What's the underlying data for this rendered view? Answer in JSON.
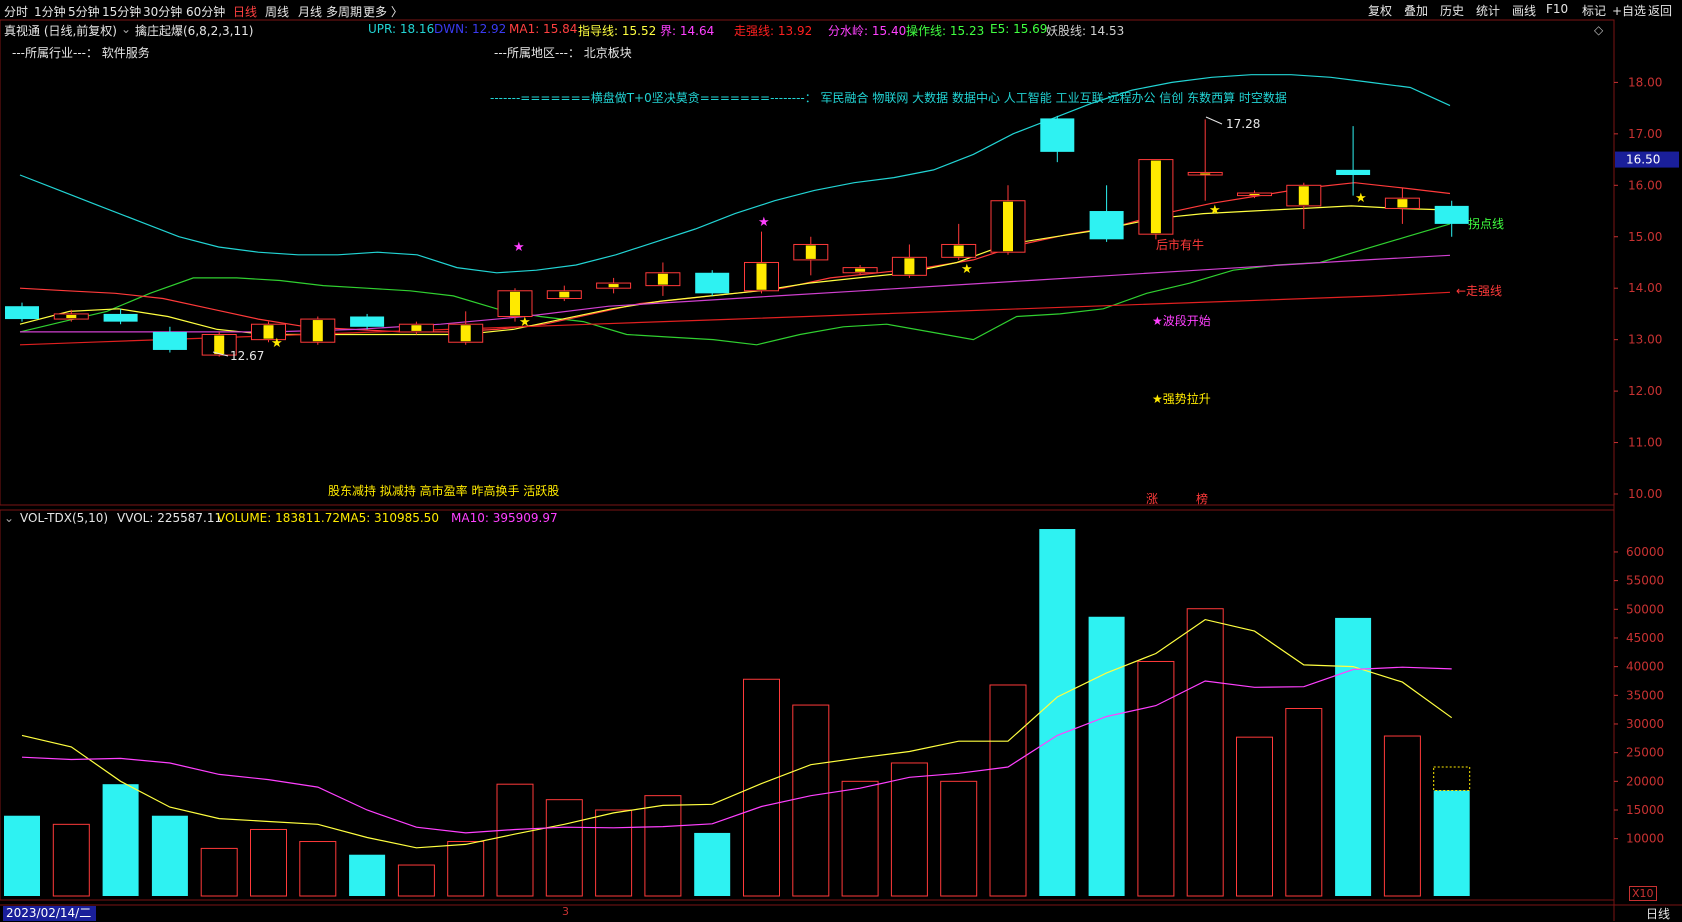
{
  "toolbar": {
    "periods": [
      "分时",
      "1分钟",
      "5分钟",
      "15分钟",
      "30分钟",
      "60分钟",
      "日线",
      "周线",
      "月线",
      "多周期",
      "更多 〉"
    ],
    "active_period": "日线",
    "right_buttons": [
      "复权",
      "叠加",
      "历史",
      "统计",
      "画线",
      "F10",
      "标记",
      "+自选",
      "返回"
    ]
  },
  "info": {
    "stock_title": "真视通 (日线,前复权)",
    "formula_name": "擒庄起爆(6,8,2,3,11)",
    "indicators": [
      {
        "label": "UPR: 18.16",
        "color": "#22d4d4"
      },
      {
        "label": "DWN: 12.92",
        "color": "#3a3af0"
      },
      {
        "label": "MA1: 15.84",
        "color": "#ff4040"
      },
      {
        "label": "指导线: 15.52",
        "color": "#ffff40"
      },
      {
        "label": "界: 14.64",
        "color": "#ff40ff"
      },
      {
        "label": "走强线: 13.92",
        "color": "#ff2020"
      },
      {
        "label": "分水岭: 15.40",
        "color": "#ff40ff"
      },
      {
        "label": "操作线: 15.23",
        "color": "#40ff40"
      },
      {
        "label": "E5: 15.69",
        "color": "#40ff40"
      },
      {
        "label": "妖股线: 14.53",
        "color": "#d0d0d0"
      }
    ],
    "industry": "---所属行业---：  软件服务",
    "region": "---所属地区---：  北京板块",
    "concept_line": "-------=======横盘做T+0坚决莫贪=======--------：  军民融合  物联网  大数据  数据中心  人工智能  工业互联  远程办公  信创  东数西算  时空数据",
    "tags": "股东减持  拟减持  高市盈率  昨高换手  活跃股"
  },
  "annotations": {
    "high_label": "17.28",
    "low_label": "12.67",
    "current_price": "16.50",
    "later_bull": "后市有牛",
    "buy_line": "拐点线",
    "strong_line": "←走强线",
    "wave_start": "★波段开始",
    "strong_pull": "★强势拉升",
    "rise_mark": "涨",
    "chip_mark": "榜",
    "diamond": "◇",
    "star_marker": "★"
  },
  "volume_info": {
    "name": "VOL-TDX(5,10)",
    "vvol": "VVOL: 225587.11",
    "volume": "VOLUME: 183811.72",
    "ma5": "MA5: 310985.50",
    "ma10": "MA10: 395909.97"
  },
  "footer": {
    "date": "2023/02/14/二",
    "period": "日线",
    "month_mark": "3",
    "x10": "X10"
  },
  "colors": {
    "up": "#ff3a3a",
    "down": "#2ef2f2",
    "upr": "#22d4d4",
    "ma1": "#ff3a3a",
    "guide": "#ffff40",
    "jie": "#d040d0",
    "strong": "#e02020",
    "green": "#30d030",
    "yellow": "#ffea00"
  },
  "chart_data": [
    {
      "type": "candlestick",
      "title": "",
      "ylim": [
        9.8,
        18.6
      ],
      "y_ticks": [
        "10.00",
        "11.00",
        "12.00",
        "13.00",
        "14.00",
        "15.00",
        "16.00",
        "17.00",
        "18.00"
      ],
      "candles": [
        {
          "o": 13.65,
          "c": 13.4,
          "h": 13.72,
          "l": 13.35
        },
        {
          "o": 13.4,
          "c": 13.5,
          "h": 13.58,
          "l": 13.35
        },
        {
          "o": 13.5,
          "c": 13.35,
          "h": 13.6,
          "l": 13.3
        },
        {
          "o": 13.15,
          "c": 12.8,
          "h": 13.25,
          "l": 12.75
        },
        {
          "o": 12.7,
          "c": 13.1,
          "h": 13.15,
          "l": 12.67
        },
        {
          "o": 13.0,
          "c": 13.3,
          "h": 13.35,
          "l": 12.95
        },
        {
          "o": 12.95,
          "c": 13.4,
          "h": 13.45,
          "l": 12.9
        },
        {
          "o": 13.45,
          "c": 13.25,
          "h": 13.5,
          "l": 13.2
        },
        {
          "o": 13.15,
          "c": 13.3,
          "h": 13.35,
          "l": 13.1
        },
        {
          "o": 12.95,
          "c": 13.3,
          "h": 13.55,
          "l": 12.9
        },
        {
          "o": 13.45,
          "c": 13.95,
          "h": 14.0,
          "l": 13.35
        },
        {
          "o": 13.8,
          "c": 13.95,
          "h": 14.05,
          "l": 13.75
        },
        {
          "o": 14.0,
          "c": 14.1,
          "h": 14.2,
          "l": 13.9
        },
        {
          "o": 14.05,
          "c": 14.3,
          "h": 14.5,
          "l": 13.85
        },
        {
          "o": 14.3,
          "c": 13.9,
          "h": 14.35,
          "l": 13.85
        },
        {
          "o": 13.95,
          "c": 14.5,
          "h": 15.1,
          "l": 13.9
        },
        {
          "o": 14.55,
          "c": 14.85,
          "h": 15.0,
          "l": 14.25
        },
        {
          "o": 14.3,
          "c": 14.4,
          "h": 14.45,
          "l": 14.25
        },
        {
          "o": 14.25,
          "c": 14.6,
          "h": 14.85,
          "l": 14.2
        },
        {
          "o": 14.6,
          "c": 14.85,
          "h": 15.25,
          "l": 14.55
        },
        {
          "o": 14.7,
          "c": 15.7,
          "h": 16.0,
          "l": 14.65
        },
        {
          "o": 17.3,
          "c": 16.65,
          "h": 17.35,
          "l": 16.45
        },
        {
          "o": 15.5,
          "c": 14.95,
          "h": 16.0,
          "l": 14.9
        },
        {
          "o": 15.05,
          "c": 16.5,
          "h": 16.5,
          "l": 14.95
        },
        {
          "o": 16.2,
          "c": 16.25,
          "h": 17.28,
          "l": 15.7
        },
        {
          "o": 15.8,
          "c": 15.85,
          "h": 15.9,
          "l": 15.75
        },
        {
          "o": 15.6,
          "c": 16.0,
          "h": 16.05,
          "l": 15.15
        },
        {
          "o": 16.3,
          "c": 16.2,
          "h": 17.15,
          "l": 15.8
        },
        {
          "o": 15.55,
          "c": 15.75,
          "h": 15.95,
          "l": 15.25
        },
        {
          "o": 15.6,
          "c": 15.25,
          "h": 15.7,
          "l": 15.0
        }
      ],
      "series": [
        {
          "name": "UPR",
          "color": "#22d4d4",
          "values": [
            16.2,
            15.9,
            15.6,
            15.3,
            15.0,
            14.8,
            14.7,
            14.65,
            14.65,
            14.7,
            14.65,
            14.4,
            14.3,
            14.35,
            14.45,
            14.65,
            14.9,
            15.15,
            15.45,
            15.7,
            15.9,
            16.05,
            16.15,
            16.3,
            16.6,
            17.0,
            17.3,
            17.6,
            17.85,
            18.0,
            18.1,
            18.15,
            18.15,
            18.1,
            18.0,
            17.9,
            17.55
          ]
        },
        {
          "name": "DWN",
          "color": "#30d030",
          "values": [
            13.15,
            13.35,
            13.55,
            13.9,
            14.2,
            14.2,
            14.15,
            14.05,
            14.0,
            13.95,
            13.85,
            13.6,
            13.45,
            13.35,
            13.1,
            13.05,
            13.0,
            12.9,
            13.1,
            13.25,
            13.3,
            13.15,
            13.0,
            13.45,
            13.5,
            13.6,
            13.9,
            14.1,
            14.35,
            14.45,
            14.5,
            14.75,
            15.0,
            15.25
          ]
        },
        {
          "name": "MA1",
          "color": "#ff3a3a",
          "values": [
            14.0,
            13.95,
            13.9,
            13.8,
            13.6,
            13.4,
            13.25,
            13.2,
            13.15,
            13.15,
            13.2,
            13.3,
            13.5,
            13.7,
            13.8,
            13.9,
            14.0,
            14.2,
            14.3,
            14.4,
            14.55,
            14.85,
            15.05,
            15.2,
            15.45,
            15.65,
            15.8,
            15.95,
            16.05,
            15.95,
            15.84
          ]
        },
        {
          "name": "指导线",
          "color": "#ffff40",
          "values": [
            13.3,
            13.55,
            13.6,
            13.45,
            13.2,
            13.1,
            13.1,
            13.1,
            13.1,
            13.1,
            13.2,
            13.4,
            13.6,
            13.75,
            13.85,
            13.95,
            14.1,
            14.2,
            14.3,
            14.5,
            14.85,
            15.0,
            15.15,
            15.35,
            15.45,
            15.5,
            15.55,
            15.6,
            15.55,
            15.52
          ]
        },
        {
          "name": "界",
          "color": "#d040d0",
          "values": [
            13.15,
            13.15,
            13.15,
            13.15,
            13.2,
            13.3,
            13.45,
            13.65,
            13.75,
            13.85,
            13.95,
            14.05,
            14.15,
            14.25,
            14.35,
            14.45,
            14.55,
            14.64
          ]
        },
        {
          "name": "走强线",
          "color": "#e02020",
          "values": [
            12.9,
            12.95,
            13.0,
            13.05,
            13.1,
            13.15,
            13.2,
            13.25,
            13.3,
            13.35,
            13.4,
            13.45,
            13.5,
            13.55,
            13.6,
            13.65,
            13.7,
            13.75,
            13.8,
            13.85,
            13.92
          ]
        }
      ]
    },
    {
      "type": "bar",
      "title": "",
      "ylim": [
        0,
        65000
      ],
      "y_ticks": [
        "10000",
        "15000",
        "20000",
        "25000",
        "30000",
        "35000",
        "40000",
        "45000",
        "50000",
        "55000",
        "60000"
      ],
      "values": [
        14000,
        12500,
        19500,
        14000,
        8300,
        11600,
        9500,
        7200,
        5400,
        9500,
        19500,
        16800,
        15000,
        17500,
        11000,
        37800,
        33300,
        20000,
        23200,
        20000,
        36800,
        64000,
        48700,
        40900,
        50100,
        27700,
        32700,
        48500,
        27900,
        18400
      ],
      "directions": [
        "down",
        "up",
        "down",
        "down",
        "up",
        "up",
        "up",
        "down",
        "up",
        "up",
        "up",
        "up",
        "up",
        "up",
        "down",
        "up",
        "up",
        "up",
        "up",
        "up",
        "up",
        "down",
        "down",
        "up",
        "up",
        "up",
        "up",
        "down",
        "up",
        "down"
      ],
      "series": [
        {
          "name": "MA5",
          "color": "#ffff40",
          "values": [
            28000,
            26000,
            20000,
            15500,
            13500,
            13000,
            12500,
            10200,
            8400,
            9000,
            10800,
            12500,
            14500,
            15800,
            16000,
            19600,
            22900,
            24100,
            25200,
            27000,
            27000,
            34700,
            38900,
            42300,
            48200,
            46200,
            40300,
            40000,
            37300,
            31100
          ]
        },
        {
          "name": "MA10",
          "color": "#ff40ff",
          "values": [
            24200,
            23800,
            24000,
            23200,
            21200,
            20300,
            19000,
            15000,
            12000,
            11000,
            11600,
            12000,
            11900,
            12100,
            12600,
            15600,
            17500,
            18800,
            20700,
            21400,
            22500,
            28000,
            31300,
            33200,
            37500,
            36400,
            36500,
            39500,
            39900,
            39600
          ]
        }
      ]
    }
  ]
}
